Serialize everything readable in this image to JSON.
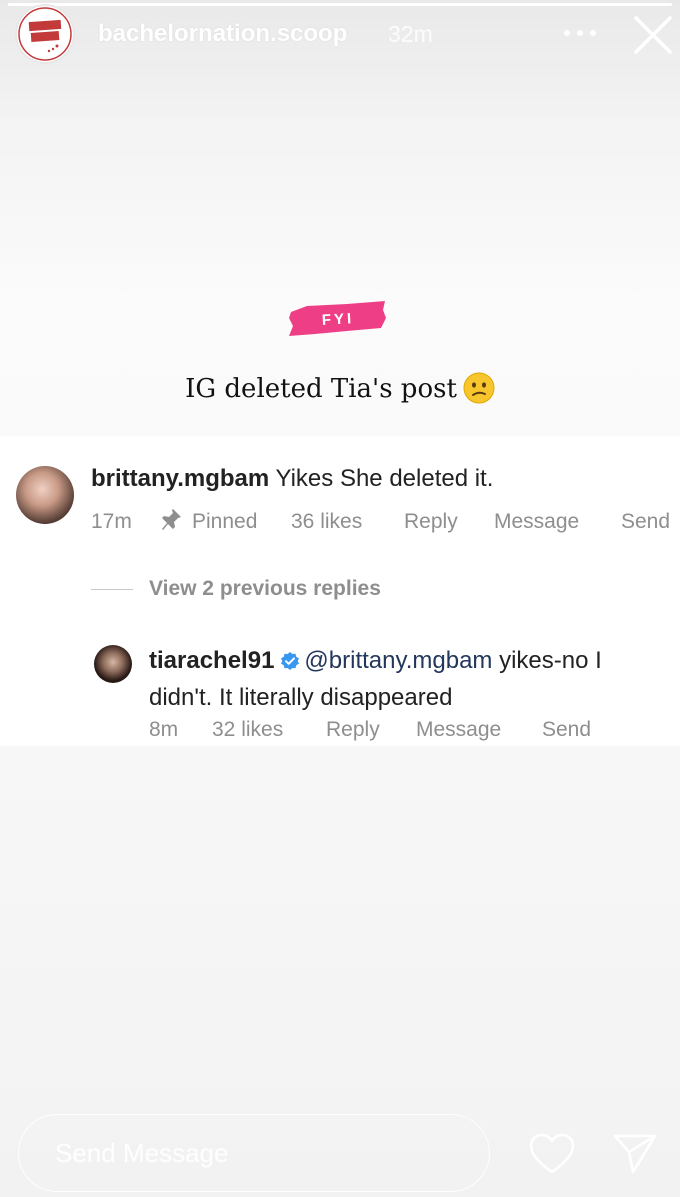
{
  "story": {
    "progress": 1.0,
    "account": "bachelornation.scoop",
    "time_ago": "32m",
    "logo_text_line1": "BACHELOR",
    "logo_text_line2": "NATION",
    "logo_text_small": "SCOOP"
  },
  "content": {
    "tag": "FYI",
    "caption": "IG deleted Tia's post",
    "caption_emoji": "confused-face-emoji",
    "tag_color": "#ee3f86"
  },
  "comment": {
    "username": "brittany.mgbam",
    "text": " Yikes She deleted it.",
    "time": "17m",
    "pinned_label": "Pinned",
    "likes": "36 likes",
    "reply": "Reply",
    "message": "Message",
    "send": "Send"
  },
  "view_replies": "View 2 previous replies",
  "reply": {
    "username": "tiarachel91",
    "verified_icon": "verified-badge-icon",
    "mention": "@brittany.mgbam",
    "text_after_mention": " yikes-no I didn't. It literally disappeared",
    "time": "8m",
    "likes": "32 likes",
    "reply": "Reply",
    "message": "Message",
    "send": "Send"
  },
  "footer": {
    "input_placeholder": "Send Message",
    "heart_icon": "heart-icon",
    "share_icon": "paper-plane-icon"
  },
  "colors": {
    "verified_blue": "#3897f0",
    "meta_gray": "#8e8e8e",
    "mention_blue": "#23375c"
  }
}
